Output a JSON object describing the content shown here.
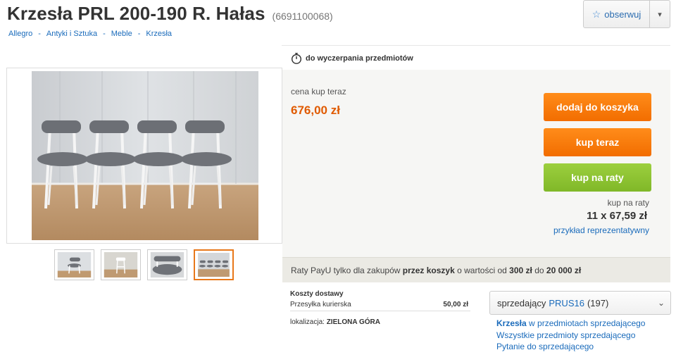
{
  "header": {
    "title": "Krzesła PRL 200-190 R. Hałas",
    "item_id": "(6691100068)",
    "observe_label": "obserwuj"
  },
  "breadcrumb": [
    "Allegro",
    "Antyki i Sztuka",
    "Meble",
    "Krzesła"
  ],
  "timer_text": "do wyczerpania przedmiotów",
  "price": {
    "label": "cena kup teraz",
    "value": "676,00 zł"
  },
  "buttons": {
    "cart": "dodaj do koszyka",
    "buy": "kup teraz",
    "raty": "kup na raty"
  },
  "installments": {
    "label": "kup na raty",
    "value": "11 x 67,59 zł",
    "link": "przykład reprezentatywny"
  },
  "payu": {
    "t1": "Raty PayU tylko dla zakupów ",
    "b1": "przez koszyk",
    "t2": " o wartości od ",
    "b2": "300 zł",
    "t3": " do ",
    "b3": "20 000 zł"
  },
  "shipping": {
    "title": "Koszty dostawy",
    "method": "Przesyłka kurierska",
    "cost": "50,00 zł",
    "location_label": "lokalizacja:",
    "location_value": "ZIELONA GÓRA"
  },
  "seller": {
    "label": "sprzedający",
    "nick": "PRUS16",
    "rating": "(197)"
  },
  "seller_links": {
    "category_bold": "Krzesła",
    "category_rest": " w przedmiotach sprzedającego",
    "all_items": "Wszystkie przedmioty sprzedającego",
    "question": "Pytanie do sprzedającego"
  },
  "icons": {
    "star": "star-icon",
    "caret": "chevron-down-icon",
    "clock": "stopwatch-icon"
  },
  "colors": {
    "price": "#e05a00",
    "orange_button": "#f26d00",
    "green_button": "#80b828",
    "link": "#1a6bbb"
  }
}
